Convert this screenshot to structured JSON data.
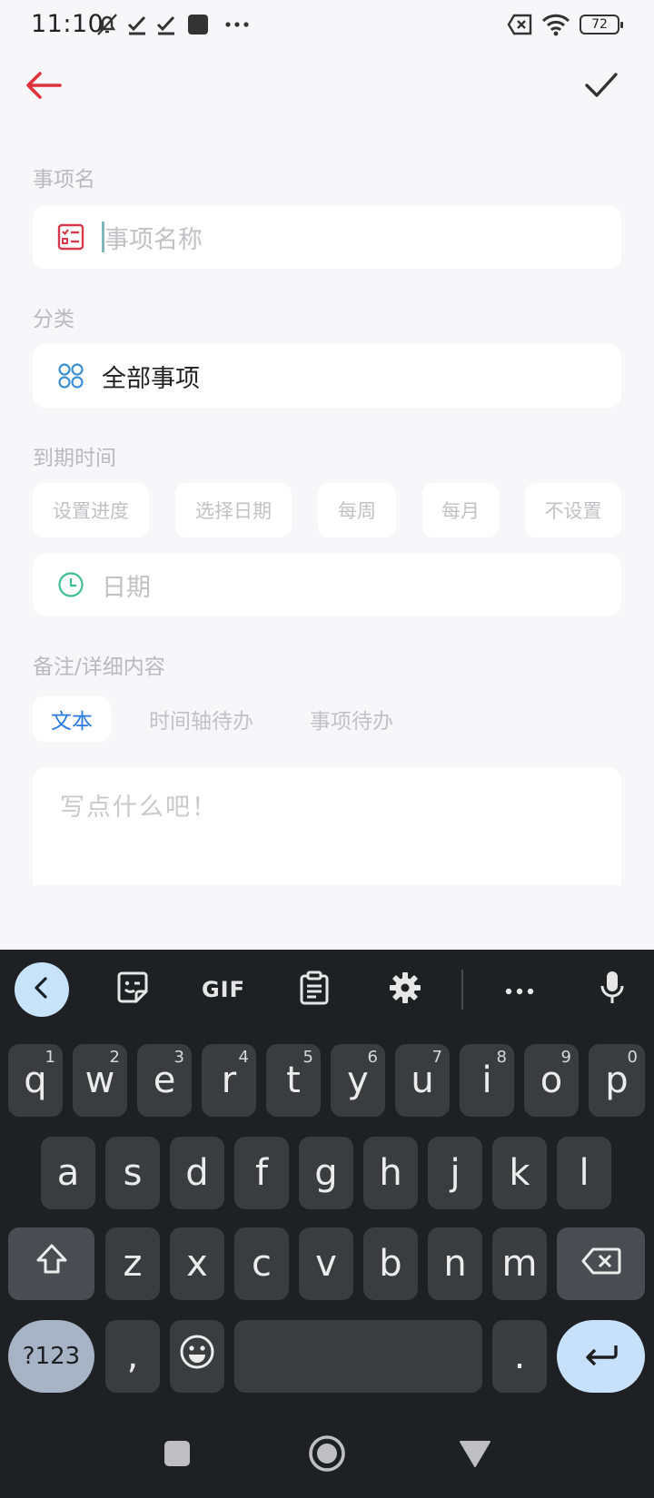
{
  "status_bar": {
    "time": "11:10",
    "battery": "72",
    "left_icons": [
      "mute-icon",
      "check-icon",
      "check-icon",
      "app-square-icon",
      "more-dots-icon"
    ],
    "right_icons": [
      "no-sim-icon",
      "wifi-icon",
      "battery-icon"
    ]
  },
  "header": {
    "back_icon": "arrow-left-icon",
    "confirm_icon": "checkmark-icon",
    "accent_color": "#e0303a"
  },
  "form": {
    "name_label": "事项名",
    "name_placeholder": "事项名称",
    "category_label": "分类",
    "category_value": "全部事项",
    "due_label": "到期时间",
    "due_options": [
      "设置进度",
      "选择日期",
      "每周",
      "每月",
      "不设置"
    ],
    "date_placeholder": "日期",
    "notes_label": "备注/详细内容",
    "notes_tabs": [
      "文本",
      "时间轴待办",
      "事项待办"
    ],
    "notes_active_tab": "文本",
    "notes_placeholder": "写点什么吧！"
  },
  "keyboard": {
    "toolbar": [
      "collapse-icon",
      "sticker-icon",
      "GIF",
      "clipboard-icon",
      "settings-icon",
      "more-icon",
      "mic-icon"
    ],
    "gif_label": "GIF",
    "row1": [
      {
        "key": "q",
        "hint": "1"
      },
      {
        "key": "w",
        "hint": "2"
      },
      {
        "key": "e",
        "hint": "3"
      },
      {
        "key": "r",
        "hint": "4"
      },
      {
        "key": "t",
        "hint": "5"
      },
      {
        "key": "y",
        "hint": "6"
      },
      {
        "key": "u",
        "hint": "7"
      },
      {
        "key": "i",
        "hint": "8"
      },
      {
        "key": "o",
        "hint": "9"
      },
      {
        "key": "p",
        "hint": "0"
      }
    ],
    "row2": [
      "a",
      "s",
      "d",
      "f",
      "g",
      "h",
      "j",
      "k",
      "l"
    ],
    "row3": [
      "z",
      "x",
      "c",
      "v",
      "b",
      "n",
      "m"
    ],
    "symbols_label": "?123",
    "comma": ",",
    "period": "."
  },
  "nav_bar": [
    "recents-icon",
    "home-icon",
    "back-icon"
  ]
}
